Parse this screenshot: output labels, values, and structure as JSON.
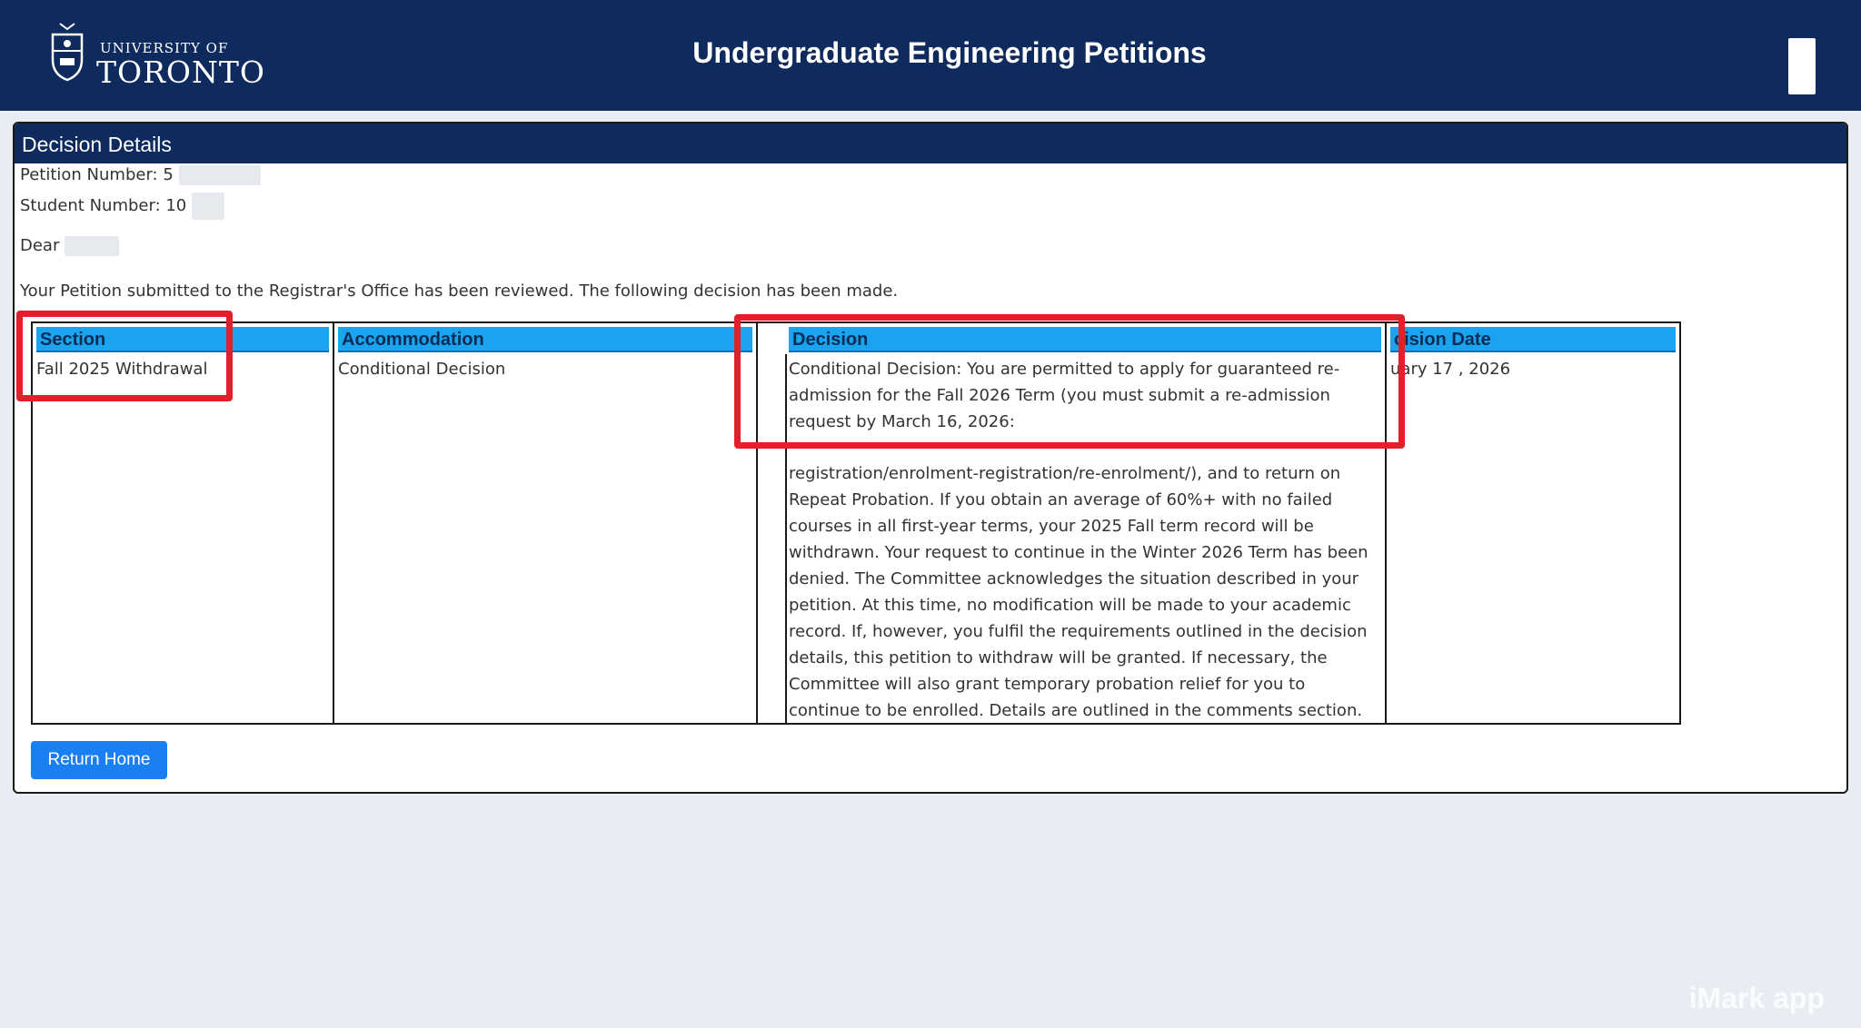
{
  "header": {
    "logo_small": "UNIVERSITY OF",
    "logo_big": "TORONTO",
    "title": "Undergraduate Engineering Petitions"
  },
  "panel": {
    "title": "Decision Details",
    "petition_label": "Petition Number: 5",
    "student_label": "Student Number: 10",
    "dear_label": "Dear",
    "intro": "Your Petition submitted to the Registrar's Office has been reviewed. The following decision has been made."
  },
  "table": {
    "headers": {
      "section": "Section",
      "accommodation": "Accommodation",
      "decision": "Decision",
      "decision_date": "cision Date"
    },
    "row": {
      "section": "Fall 2025 Withdrawal",
      "accommodation": "Conditional Decision",
      "decision": "Conditional Decision: You are permitted to apply for guaranteed re-admission for the Fall 2026 Term (you must submit a re-admission request by March 16, 2026:",
      "decision_cont": "registration/enrolment-registration/re-enrolment/), and to return on Repeat Probation. If you obtain an average of 60%+ with no failed courses in all first-year terms, your 2025 Fall term record will be withdrawn. Your request to continue in the Winter 2026 Term has been denied. The Committee acknowledges the situation described in your petition. At this time, no modification will be made to your academic record. If, however, you fulfil the requirements outlined in the decision details, this petition to withdraw will be granted. If necessary, the Committee will also grant temporary probation relief for you to continue to be enrolled. Details are outlined in the comments section.",
      "decision_date": "uary 17 , 2026"
    }
  },
  "return_button": "Return Home",
  "watermark": "iMark app",
  "colors": {
    "header_bg": "#0f2a5c",
    "table_header_bg": "#1aa3ee",
    "highlight": "#e41e2b",
    "button_bg": "#1a7ff2"
  }
}
